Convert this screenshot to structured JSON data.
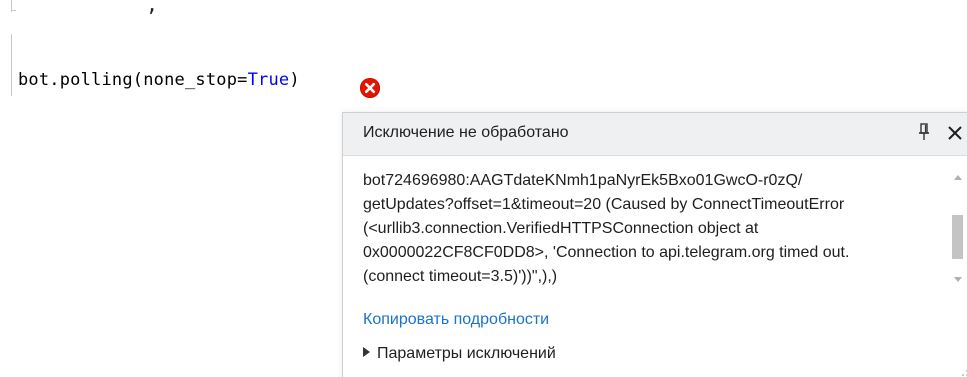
{
  "editor": {
    "code_fragment": ",",
    "code_line": {
      "prefix": "bot.polling(none_stop=",
      "keyword": "True",
      "suffix": ")"
    },
    "error_icon": "error-circle-x-icon"
  },
  "exception_popup": {
    "title": "Исключение не обработано",
    "pin_icon": "pin-icon",
    "close_icon": "close-icon",
    "message_lines": [
      "bot724696980:AAGTdateKNmh1paNyrEk5Bxo01GwcO-r0zQ/",
      "getUpdates?offset=1&timeout=20 (Caused by ConnectTimeoutError",
      "(<urllib3.connection.VerifiedHTTPSConnection object at",
      "0x0000022CF8CF0DD8>, 'Connection to api.telegram.org timed out.",
      "(connect timeout=3.5)'))\",),)"
    ],
    "copy_details_link": "Копировать подробности",
    "exception_settings": "Параметры исключений"
  },
  "colors": {
    "error_red": "#e51400",
    "keyword_blue": "#0000ff",
    "link_blue": "#1a73c9",
    "header_bg": "#eef0f2"
  }
}
